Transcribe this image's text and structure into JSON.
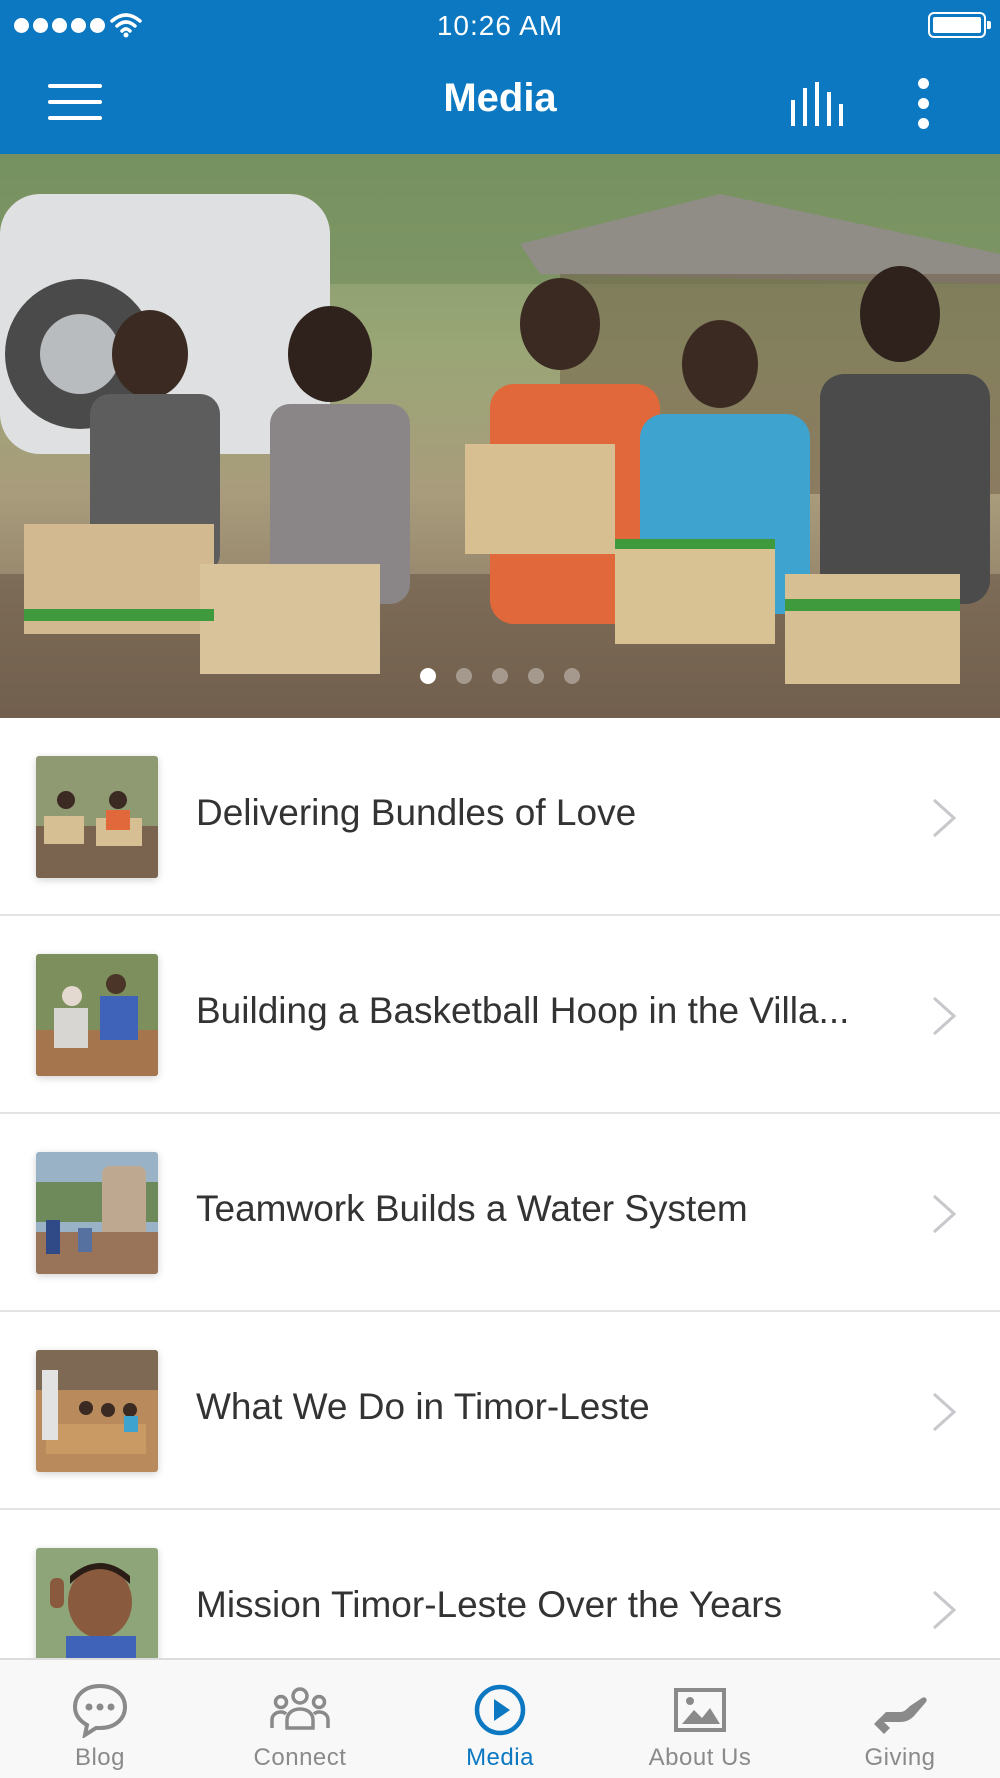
{
  "status_bar": {
    "time": "10:26 AM"
  },
  "nav": {
    "title": "Media"
  },
  "hero": {
    "slide_count": 5,
    "active_slide": 1
  },
  "media_items": [
    {
      "title": "Delivering Bundles of Love"
    },
    {
      "title": "Building a Basketball Hoop in the Villa..."
    },
    {
      "title": "Teamwork Builds a Water System"
    },
    {
      "title": "What We Do in Timor-Leste"
    },
    {
      "title": "Mission Timor-Leste Over the Years"
    }
  ],
  "tabs": [
    {
      "label": "Blog",
      "icon": "chat-bubble-icon"
    },
    {
      "label": "Connect",
      "icon": "people-group-icon"
    },
    {
      "label": "Media",
      "icon": "play-circle-icon",
      "active": true
    },
    {
      "label": "About Us",
      "icon": "picture-icon"
    },
    {
      "label": "Giving",
      "icon": "giving-hand-icon"
    }
  ],
  "colors": {
    "brand": "#0b78c1",
    "tab_inactive": "#8a8a8a",
    "separator": "#e3e3e3"
  }
}
